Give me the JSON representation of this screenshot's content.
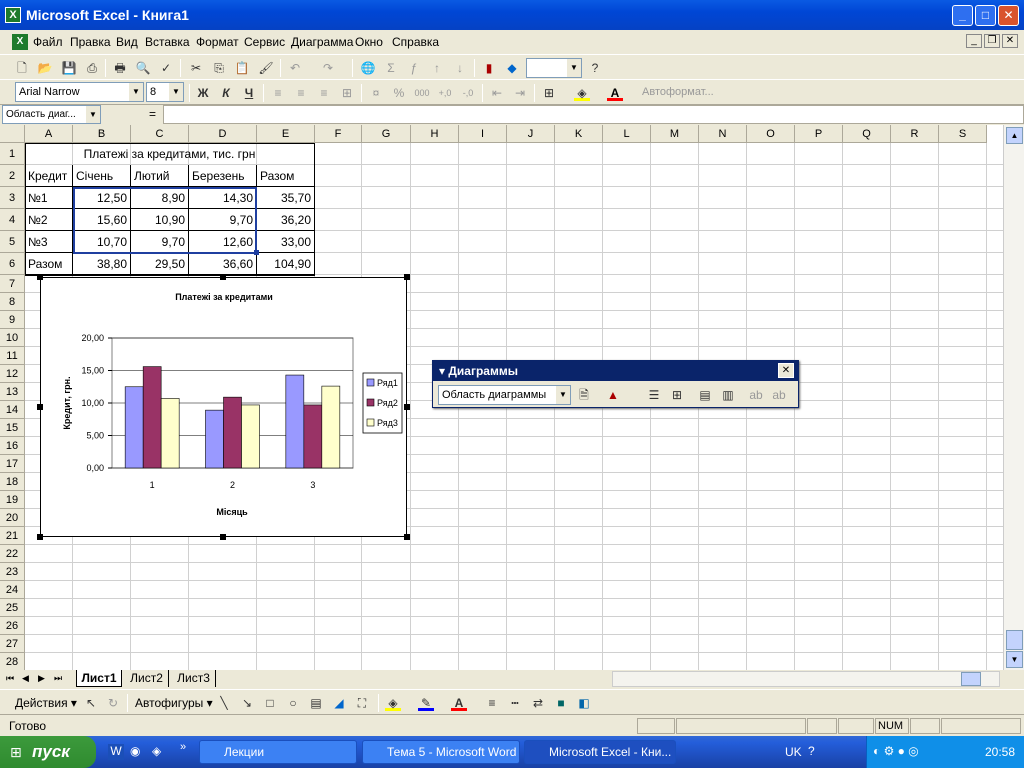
{
  "window": {
    "title": "Microsoft Excel - Книга1"
  },
  "menu": [
    "Файл",
    "Правка",
    "Вид",
    "Вставка",
    "Формат",
    "Сервис",
    "Диаграмма",
    "Окно",
    "Справка"
  ],
  "format_bar": {
    "font": "Arial Narrow",
    "size": "8",
    "bold": "Ж",
    "italic": "К",
    "underline": "Ч",
    "autoformat": "Автоформат..."
  },
  "formula_bar": {
    "name_box": "Область диаг...",
    "eq": "="
  },
  "columns": [
    "A",
    "B",
    "C",
    "D",
    "E",
    "F",
    "G",
    "H",
    "I",
    "J",
    "K",
    "L",
    "M",
    "N",
    "O",
    "P",
    "Q",
    "R",
    "S"
  ],
  "rows": [
    "1",
    "2",
    "3",
    "4",
    "5",
    "6",
    "7",
    "8",
    "9",
    "10",
    "11",
    "12",
    "13",
    "14",
    "15",
    "16",
    "17",
    "18",
    "19",
    "20",
    "21",
    "22",
    "23",
    "24",
    "25",
    "26",
    "27",
    "28"
  ],
  "table": {
    "title": "Платежі за кредитами, тис. грн",
    "headers": [
      "Кредит",
      "Січень",
      "Лютий",
      "Березень",
      "Разом"
    ],
    "rows": [
      [
        "№1",
        "12,50",
        "8,90",
        "14,30",
        "35,70"
      ],
      [
        "№2",
        "15,60",
        "10,90",
        "9,70",
        "36,20"
      ],
      [
        "№3",
        "10,70",
        "9,70",
        "12,60",
        "33,00"
      ],
      [
        "Разом",
        "38,80",
        "29,50",
        "36,60",
        "104,90"
      ]
    ]
  },
  "chart_data": {
    "type": "bar",
    "title": "Платежі за кредитами",
    "xlabel": "Місяць",
    "ylabel": "Кредит, грн.",
    "categories": [
      "1",
      "2",
      "3"
    ],
    "ylim": [
      0,
      20
    ],
    "yticks": [
      "0,00",
      "5,00",
      "10,00",
      "15,00",
      "20,00"
    ],
    "legend": "right",
    "series": [
      {
        "name": "Ряд1",
        "values": [
          12.5,
          8.9,
          14.3
        ],
        "color": "#9999ff"
      },
      {
        "name": "Ряд2",
        "values": [
          15.6,
          10.9,
          9.7
        ],
        "color": "#993366"
      },
      {
        "name": "Ряд3",
        "values": [
          10.7,
          9.7,
          12.6
        ],
        "color": "#ffffcc"
      }
    ]
  },
  "chart_toolbar": {
    "title": "Диаграммы",
    "combo": "Область диаграммы"
  },
  "sheet_tabs": [
    "Лист1",
    "Лист2",
    "Лист3"
  ],
  "draw_bar": {
    "actions": "Действия",
    "autoshapes": "Автофигуры"
  },
  "status": {
    "text": "Готово",
    "num": "NUM"
  },
  "taskbar": {
    "start": "пуск",
    "tasks": [
      "Лекции",
      "Тема 5 - Microsoft Word",
      "Microsoft Excel - Кни..."
    ],
    "lang": "UK",
    "time": "20:58"
  }
}
